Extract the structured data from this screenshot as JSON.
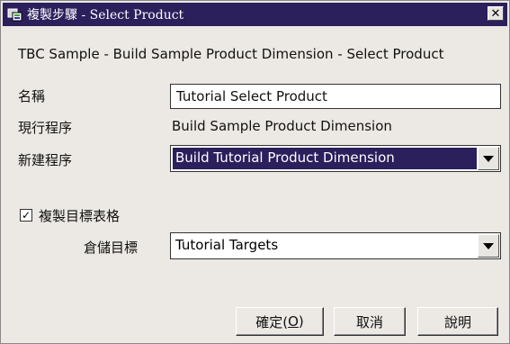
{
  "window": {
    "title": "複製步驟 - Select Product",
    "close_label": "✕"
  },
  "subtitle": "TBC Sample - Build Sample Product Dimension - Select Product",
  "form": {
    "name_label": "名稱",
    "name_value": "Tutorial Select Product",
    "current_process_label": "現行程序",
    "current_process_value": "Build Sample Product Dimension",
    "new_process_label": "新建程序",
    "new_process_value": "Build Tutorial Product Dimension",
    "copy_targets_label": "複製目標表格",
    "copy_targets_checked": true,
    "repository_target_label": "倉儲目標",
    "repository_target_value": "Tutorial Targets"
  },
  "buttons": {
    "ok_label": "確定(",
    "ok_mnemonic": "O",
    "ok_suffix": ")",
    "cancel_label": "取消",
    "help_label": "說明"
  },
  "colors": {
    "titlebar": "#2b1f5c",
    "selection": "#2b1f5c",
    "dialog_bg": "#ece9e4"
  }
}
